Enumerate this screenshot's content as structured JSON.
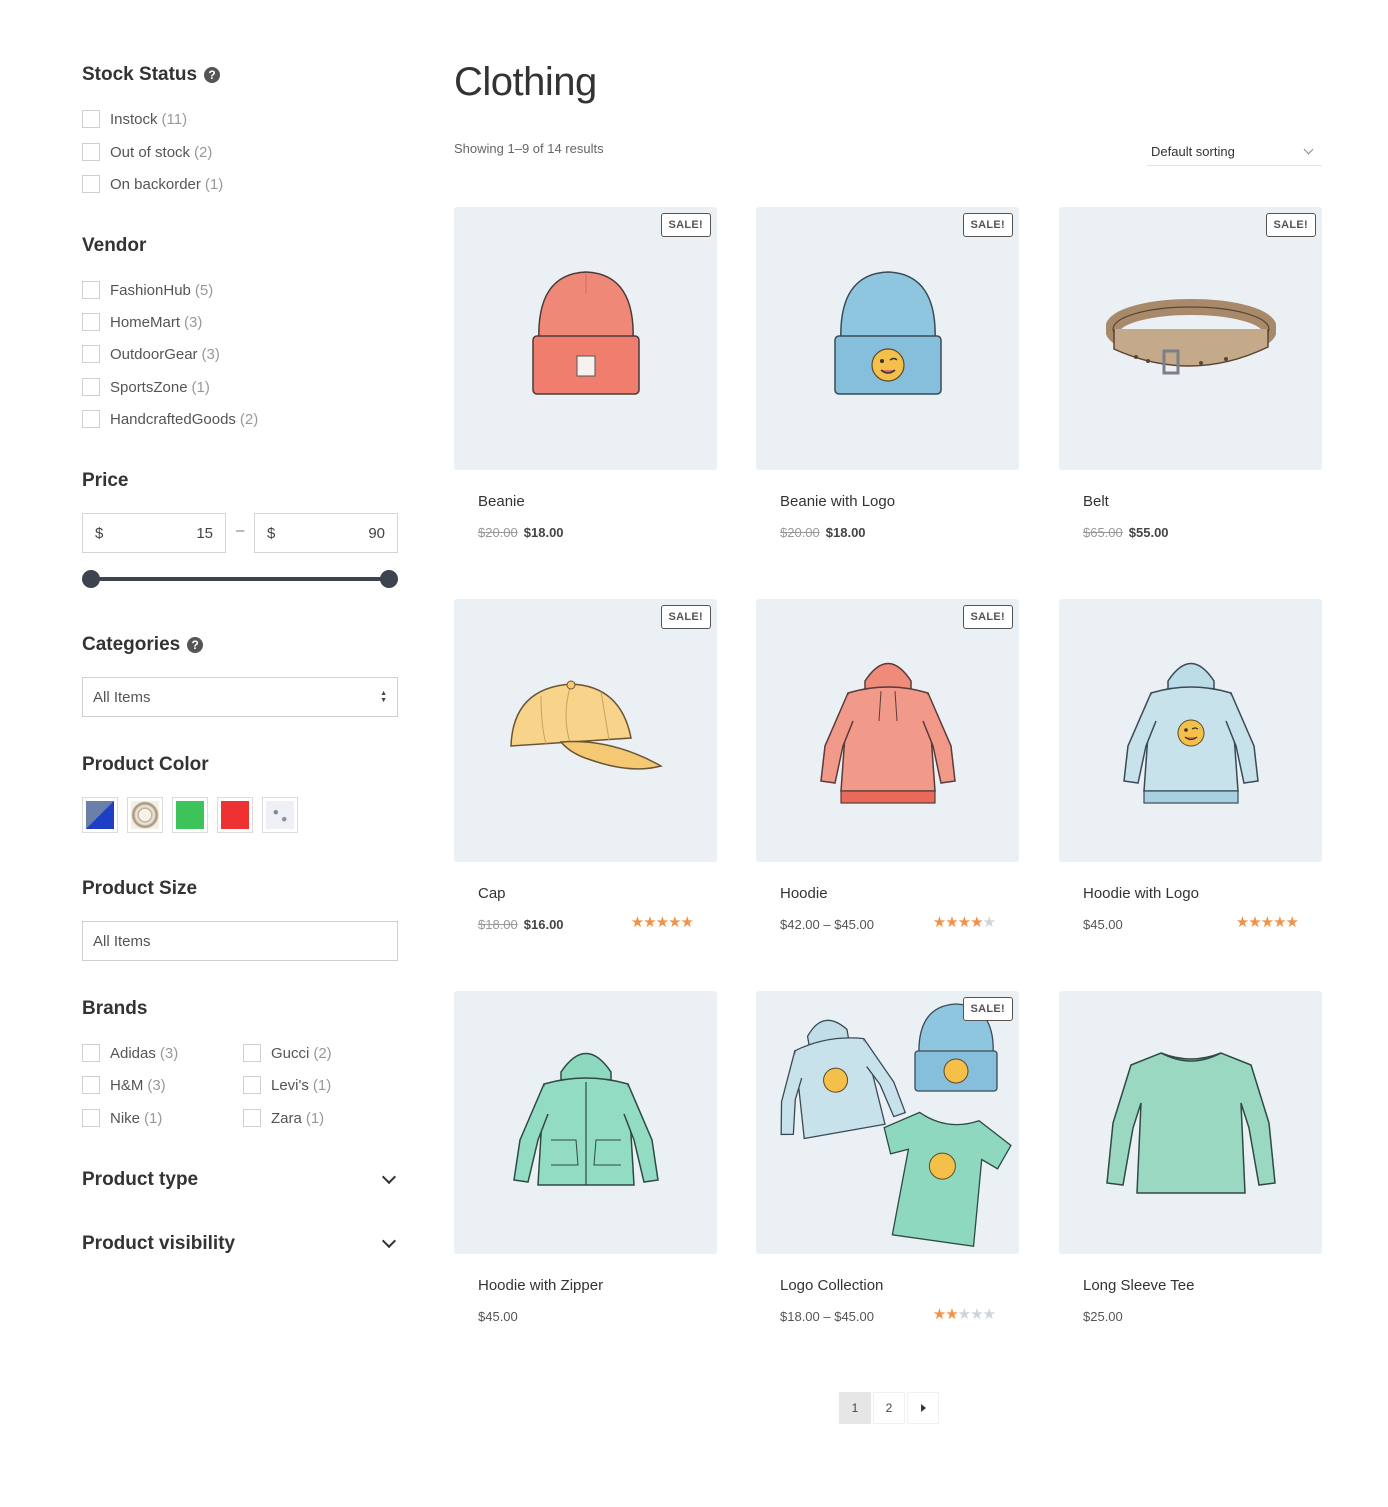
{
  "sidebar": {
    "stock_status": {
      "title": "Stock Status",
      "help_icon": "?",
      "items": [
        {
          "label": "Instock",
          "count": "(11)"
        },
        {
          "label": "Out of stock",
          "count": "(2)"
        },
        {
          "label": "On backorder",
          "count": "(1)"
        }
      ]
    },
    "vendor": {
      "title": "Vendor",
      "items": [
        {
          "label": "FashionHub",
          "count": "(5)"
        },
        {
          "label": "HomeMart",
          "count": "(3)"
        },
        {
          "label": "OutdoorGear",
          "count": "(3)"
        },
        {
          "label": "SportsZone",
          "count": "(1)"
        },
        {
          "label": "HandcraftedGoods",
          "count": "(2)"
        }
      ]
    },
    "price": {
      "title": "Price",
      "currency": "$",
      "min": "15",
      "max": "90",
      "separator": "–"
    },
    "categories": {
      "title": "Categories",
      "help_icon": "?",
      "selected": "All Items"
    },
    "product_color": {
      "title": "Product Color",
      "swatches": [
        "blue-grey",
        "floral-pattern",
        "#3cc35a",
        "#ee3232",
        "grey-pattern"
      ]
    },
    "product_size": {
      "title": "Product Size",
      "selected": "All Items"
    },
    "brands": {
      "title": "Brands",
      "items": [
        {
          "label": "Adidas",
          "count": "(3)"
        },
        {
          "label": "Gucci",
          "count": "(2)"
        },
        {
          "label": "H&M",
          "count": "(3)"
        },
        {
          "label": "Levi's",
          "count": "(1)"
        },
        {
          "label": "Nike",
          "count": "(1)"
        },
        {
          "label": "Zara",
          "count": "(1)"
        }
      ]
    },
    "product_type": {
      "title": "Product type"
    },
    "product_visibility": {
      "title": "Product visibility"
    }
  },
  "main": {
    "title": "Clothing",
    "result_count": "Showing 1–9 of 14 results",
    "sorting": "Default sorting",
    "sale_label": "SALE!",
    "products": [
      {
        "name": "Beanie",
        "old_price": "$20.00",
        "price": "$18.00",
        "sale": true,
        "rating": 0,
        "image": "beanie-red"
      },
      {
        "name": "Beanie with Logo",
        "old_price": "$20.00",
        "price": "$18.00",
        "sale": true,
        "rating": 0,
        "image": "beanie-blue-logo"
      },
      {
        "name": "Belt",
        "old_price": "$65.00",
        "price": "$55.00",
        "sale": true,
        "rating": 0,
        "image": "belt"
      },
      {
        "name": "Cap",
        "old_price": "$18.00",
        "price": "$16.00",
        "sale": true,
        "rating": 5,
        "image": "cap"
      },
      {
        "name": "Hoodie",
        "old_price": "",
        "price": "$42.00 – $45.00",
        "sale": true,
        "rating": 4,
        "image": "hoodie-red"
      },
      {
        "name": "Hoodie with Logo",
        "old_price": "",
        "price": "$45.00",
        "sale": false,
        "rating": 5,
        "image": "hoodie-blue-logo"
      },
      {
        "name": "Hoodie with Zipper",
        "old_price": "",
        "price": "$45.00",
        "sale": false,
        "rating": 0,
        "image": "hoodie-zipper"
      },
      {
        "name": "Logo Collection",
        "old_price": "",
        "price": "$18.00 – $45.00",
        "sale": true,
        "rating": 2,
        "image": "logo-collection"
      },
      {
        "name": "Long Sleeve Tee",
        "old_price": "",
        "price": "$25.00",
        "sale": false,
        "rating": 0,
        "image": "long-sleeve-tee"
      }
    ],
    "pagination": {
      "pages": [
        "1",
        "2"
      ],
      "current": "1"
    }
  }
}
